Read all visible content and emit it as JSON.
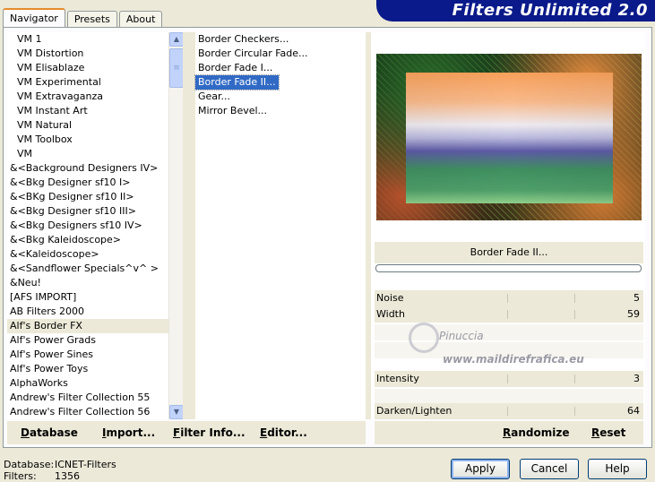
{
  "app": {
    "title": "Filters Unlimited 2.0"
  },
  "tabs": [
    {
      "label": "Navigator",
      "active": true
    },
    {
      "label": "Presets",
      "active": false
    },
    {
      "label": "About",
      "active": false
    }
  ],
  "categories": [
    "VM 1",
    "VM Distortion",
    "VM Elisablaze",
    "VM Experimental",
    "VM Extravaganza",
    "VM Instant Art",
    "VM Natural",
    "VM Toolbox",
    "VM",
    "&<Background Designers IV>",
    "&<Bkg Designer sf10 I>",
    "&<BKg Designer sf10 II>",
    "&<Bkg Designer sf10 III>",
    "&<Bkg Designers sf10 IV>",
    "&<Bkg Kaleidoscope>",
    "&<Kaleidoscope>",
    "&<Sandflower Specials^v^ >",
    "&Neu!",
    "[AFS IMPORT]",
    "AB Filters 2000",
    "Alf's Border FX",
    "Alf's Power Grads",
    "Alf's Power Sines",
    "Alf's Power Toys",
    "AlphaWorks",
    "Andrew's Filter Collection 55",
    "Andrew's Filter Collection 56"
  ],
  "selected_category": "Alf's Border FX",
  "filters": [
    "Border Checkers...",
    "Border Circular Fade...",
    "Border Fade I...",
    "Border Fade II...",
    "Gear...",
    "Mirror Bevel..."
  ],
  "selected_filter": "Border Fade II...",
  "filter_name": "Border Fade II...",
  "params": {
    "noise": {
      "label": "Noise",
      "value": "5"
    },
    "width": {
      "label": "Width",
      "value": "59"
    },
    "intensity": {
      "label": "Intensity",
      "value": "3"
    },
    "darken": {
      "label": "Darken/Lighten",
      "value": "64"
    }
  },
  "watermark": {
    "name": "Pinuccia",
    "url": "www.maildirefrafica.eu"
  },
  "bottom_links": {
    "database": "Database",
    "import": "Import...",
    "filter_info": "Filter Info...",
    "editor": "Editor...",
    "randomize": "Randomize",
    "reset": "Reset"
  },
  "status": {
    "database_label": "Database:",
    "database_value": "ICNET-Filters",
    "filters_label": "Filters:",
    "filters_value": "1356"
  },
  "buttons": {
    "apply": "Apply",
    "cancel": "Cancel",
    "help": "Help"
  }
}
